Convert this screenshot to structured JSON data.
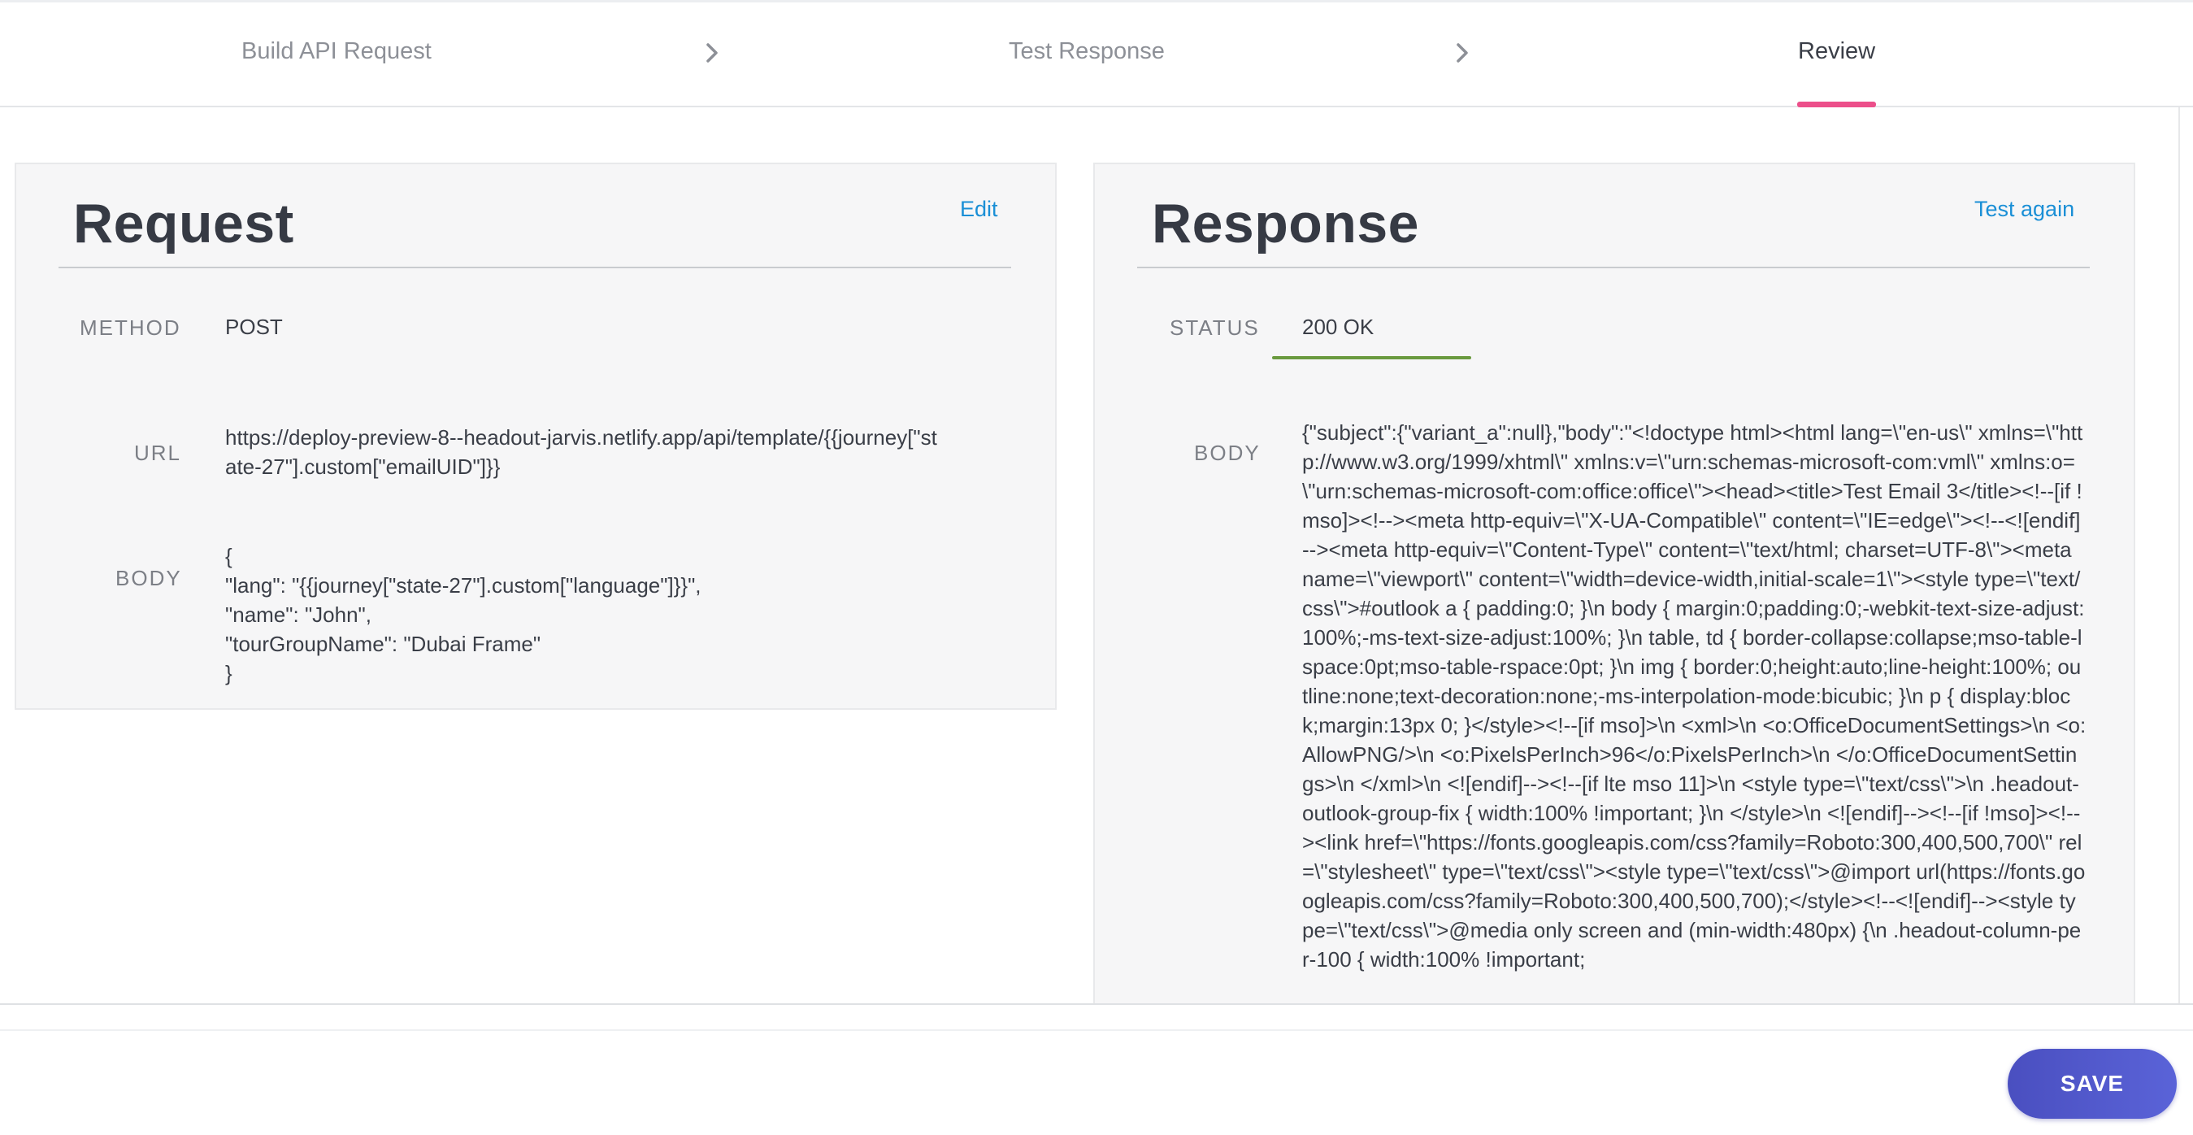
{
  "stepper": {
    "steps": [
      {
        "label": "Build API Request"
      },
      {
        "label": "Test Response"
      },
      {
        "label": "Review"
      }
    ],
    "active_color": "#ec4f8a"
  },
  "request": {
    "title": "Request",
    "edit_label": "Edit",
    "method_label": "METHOD",
    "method_value": "POST",
    "url_label": "URL",
    "url_line1": "https://deploy-preview-8--headout-jarvis.netlify.app/api/template/{{journey[\"st",
    "url_line2": "ate-27\"].custom[\"emailUID\"]}}",
    "body_label": "BODY",
    "body_lines": [
      "{",
      "\"lang\": \"{{journey[\"state-27\"].custom[\"language\"]}}\",",
      "\"name\": \"John\",",
      "\"tourGroupName\": \"Dubai Frame\"",
      "}"
    ]
  },
  "response": {
    "title": "Response",
    "test_again_label": "Test again",
    "status_label": "STATUS",
    "status_value": "200 OK",
    "status_color": "#6a9a3f",
    "body_label": "BODY",
    "body_text": "{\"subject\":{\"variant_a\":null},\"body\":\"<!doctype html><html lang=\\\"en-us\\\" xmlns=\\\"http://www.w3.org/1999/xhtml\\\" xmlns:v=\\\"urn:schemas-microsoft-com:vml\\\" xmlns:o=\\\"urn:schemas-microsoft-com:office:office\\\"><head><title>Test Email 3</title><!--[if !mso]><!--><meta http-equiv=\\\"X-UA-Compatible\\\" content=\\\"IE=edge\\\"><!--<![endif]--><meta http-equiv=\\\"Content-Type\\\" content=\\\"text/html; charset=UTF-8\\\"><meta name=\\\"viewport\\\" content=\\\"width=device-width,initial-scale=1\\\"><style type=\\\"text/css\\\">#outlook a { padding:0; }\\n body { margin:0;padding:0;-webkit-text-size-adjust:100%;-ms-text-size-adjust:100%; }\\n table, td { border-collapse:collapse;mso-table-lspace:0pt;mso-table-rspace:0pt; }\\n img { border:0;height:auto;line-height:100%; outline:none;text-decoration:none;-ms-interpolation-mode:bicubic; }\\n p { display:block;margin:13px 0; }</style><!--[if mso]>\\n <xml>\\n <o:OfficeDocumentSettings>\\n <o:AllowPNG/>\\n <o:PixelsPerInch>96</o:PixelsPerInch>\\n </o:OfficeDocumentSettings>\\n </xml>\\n <![endif]--><!--[if lte mso 11]>\\n <style type=\\\"text/css\\\">\\n .headout-outlook-group-fix { width:100% !important; }\\n </style>\\n <![endif]--><!--[if !mso]><!--><link href=\\\"https://fonts.googleapis.com/css?family=Roboto:300,400,500,700\\\" rel=\\\"stylesheet\\\" type=\\\"text/css\\\"><style type=\\\"text/css\\\">@import url(https://fonts.googleapis.com/css?family=Roboto:300,400,500,700);</style><!--<![endif]--><style type=\\\"text/css\\\">@media only screen and (min-width:480px) {\\n .headout-column-per-100 { width:100% !important;"
  },
  "footer": {
    "save_label": "SAVE",
    "save_color": "#4a4fc0"
  }
}
